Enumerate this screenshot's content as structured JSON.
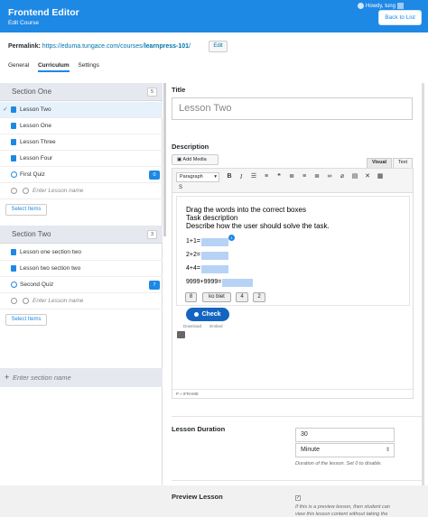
{
  "header": {
    "title": "Frontend Editor",
    "subtitle": "Edit Course",
    "user_greeting": "Howdy, tung",
    "back_button": "Back to List"
  },
  "permalink": {
    "label": "Permalink:",
    "url_base": "https://eduma.tungace.com/courses/",
    "slug": "learnpress-101",
    "url_end": "/",
    "edit_button": "Edit"
  },
  "tabs": [
    "General",
    "Curriculum",
    "Settings"
  ],
  "curriculum": {
    "sections": [
      {
        "name": "Section One",
        "count": "5",
        "items": [
          {
            "label": "Lesson Two",
            "type": "lesson",
            "selected": true
          },
          {
            "label": "Lesson One",
            "type": "lesson"
          },
          {
            "label": "Lesson Three",
            "type": "lesson"
          },
          {
            "label": "Lesson Four",
            "type": "lesson"
          },
          {
            "label": "First Quiz",
            "type": "quiz",
            "badge": "0"
          }
        ],
        "new_item_placeholder": "Enter Lesson name",
        "select_items": "Select Items"
      },
      {
        "name": "Section Two",
        "count": "3",
        "items": [
          {
            "label": "Lesson one section two",
            "type": "lesson"
          },
          {
            "label": "Lesson two section two",
            "type": "lesson"
          },
          {
            "label": "Second Quiz",
            "type": "quiz",
            "badge": "7"
          }
        ],
        "new_item_placeholder": "Enter Lesson name",
        "select_items": "Select Items"
      }
    ],
    "add_section_placeholder": "Enter section name",
    "add_section_icon": "plus-icon"
  },
  "editor": {
    "title_label": "Title",
    "title_value": "Lesson Two",
    "description_label": "Description",
    "add_media": "Add Media",
    "tab_visual": "Visual",
    "tab_text": "Text",
    "format_select": "Paragraph",
    "content": {
      "line1": "Drag the words into the correct boxes",
      "line2": "Task description",
      "line3": "Describe how the user should solve the task.",
      "eq1": "1+1=",
      "eq2": "2+2=",
      "eq3": "4+4=",
      "eq4": "9999+9999=",
      "drop_badge": "1",
      "words": [
        "8",
        "ko biet",
        "4",
        "2"
      ],
      "check_button": "Check",
      "download": "Download",
      "embed": "Embed"
    },
    "status_path": "P » IFRAME"
  },
  "duration": {
    "label": "Lesson Duration",
    "value": "30",
    "unit": "Minute",
    "hint": "Duration of the lesson. Set 0 to disable."
  },
  "preview": {
    "label": "Preview Lesson",
    "hint1": "If this is a preview lesson, then student can",
    "hint2": "view this lesson content without taking the"
  },
  "colors": {
    "brand": "#1e88e5",
    "check_button": "#1565c0",
    "section_header": "#e5e8ee"
  }
}
